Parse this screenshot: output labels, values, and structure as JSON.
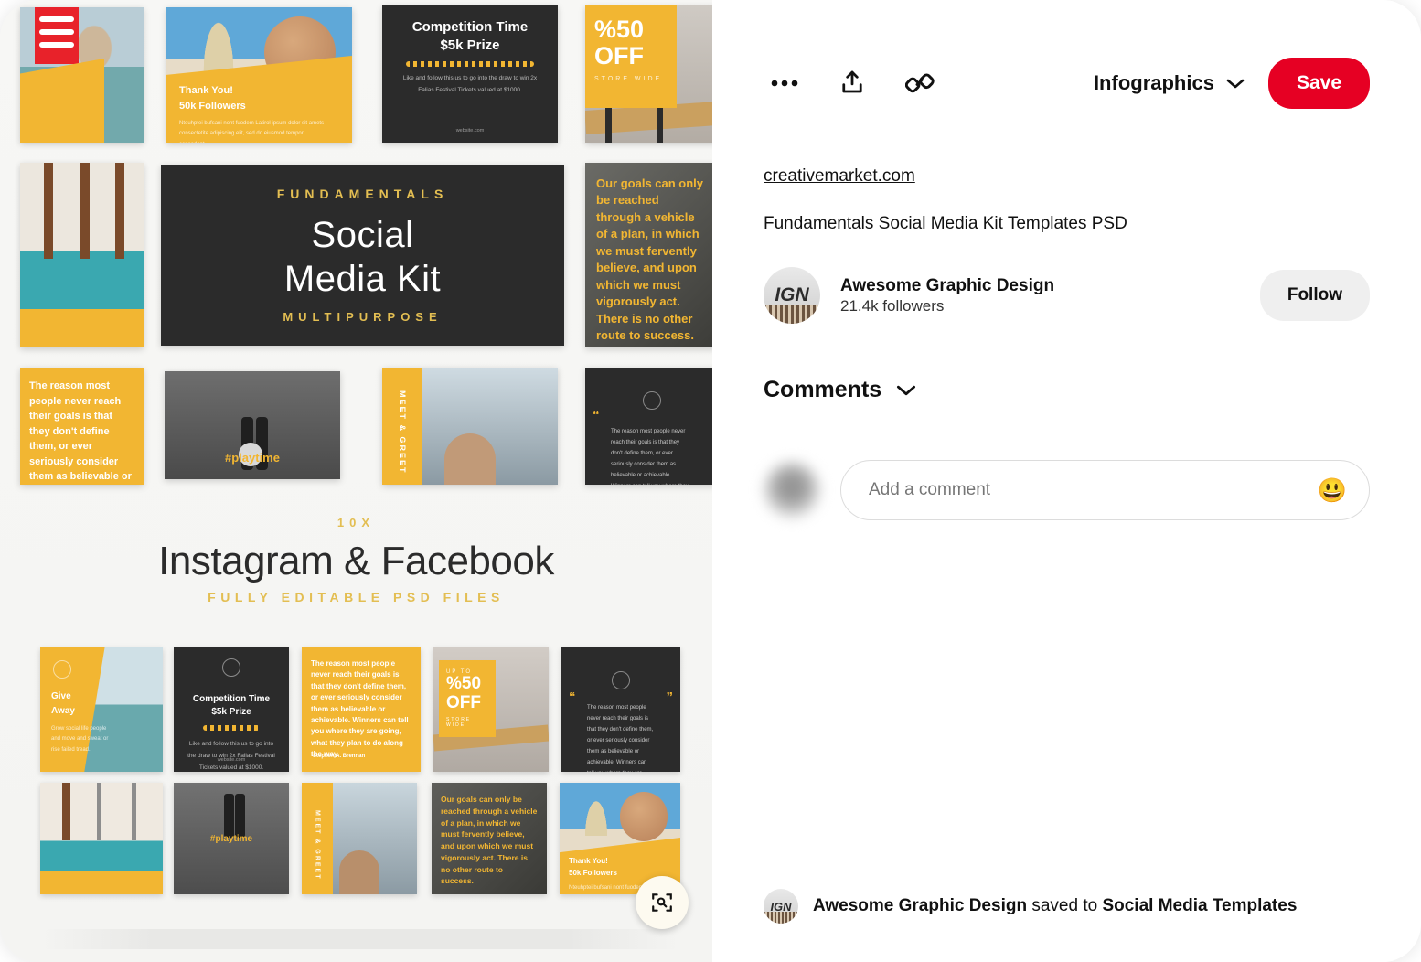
{
  "header": {
    "more_label": "•••",
    "share_icon": "share-icon",
    "link_icon": "link-icon",
    "board_name": "Infographics",
    "chevron": "chevron-down-icon",
    "save_label": "Save",
    "save_color": "#e60023"
  },
  "pin": {
    "source_link": "creativemarket.com",
    "title": "Fundamentals Social Media Kit Templates PSD"
  },
  "creator": {
    "avatar_initials": "IGN",
    "name": "Awesome Graphic Design",
    "followers": "21.4k followers",
    "follow_label": "Follow"
  },
  "comments": {
    "heading": "Comments",
    "chevron": "chevron-down-icon",
    "placeholder": "Add a comment",
    "value": "",
    "emoji": "😃"
  },
  "saved": {
    "avatar_initials": "IGN",
    "user": "Awesome Graphic Design",
    "middle": " saved to ",
    "board": "Social Media Templates"
  },
  "image": {
    "visual_search_icon": "visual-search-icon",
    "banner": {
      "eyebrow": "10X",
      "headline": "Instagram & Facebook",
      "subline": "FULLY EDITABLE PSD FILES"
    },
    "hero": {
      "eyebrow": "FUNDAMENTALS",
      "line1": "Social",
      "line2": "Media Kit",
      "subline": "MULTIPURPOSE"
    },
    "cards": {
      "thank_you_l1": "Thank You!",
      "thank_you_l2": "50k Followers",
      "thank_you_body": "Nteuhptei bufsani nont fuodem Latirol ipsum dolor sit amets consectetite adipiscing elit, sed do eiusmod tempor consodant.",
      "competition_l1": "Competition Time",
      "competition_l2": "$5k Prize",
      "competition_body": "Like and follow this us to go into the draw to win 2x Falias Festival Tickets valued at $1000.",
      "competition_site": "website.com",
      "off_number": "%50",
      "off_word": "OFF",
      "off_sub": "STORE WIDE",
      "quote_text": "Our goals can only be reached through a vehicle of a plan, in which we must fervently believe, and upon which we must vigorously act. There is no other route to success.",
      "quote_author": "-Stephen A. Brennan",
      "amber_quote": "The reason most people never reach their goals is that they don't define them, or ever seriously consider them as believable or achievable. Winners can tell you where they are going, what they plan to do along the way.",
      "playtime": "#playtime",
      "meet_greet": "MEET & GREET",
      "give_away_l1": "Give",
      "give_away_l2": "Away",
      "give_away_body": "Grow social life people and move and sweat or rise failed tread."
    }
  }
}
